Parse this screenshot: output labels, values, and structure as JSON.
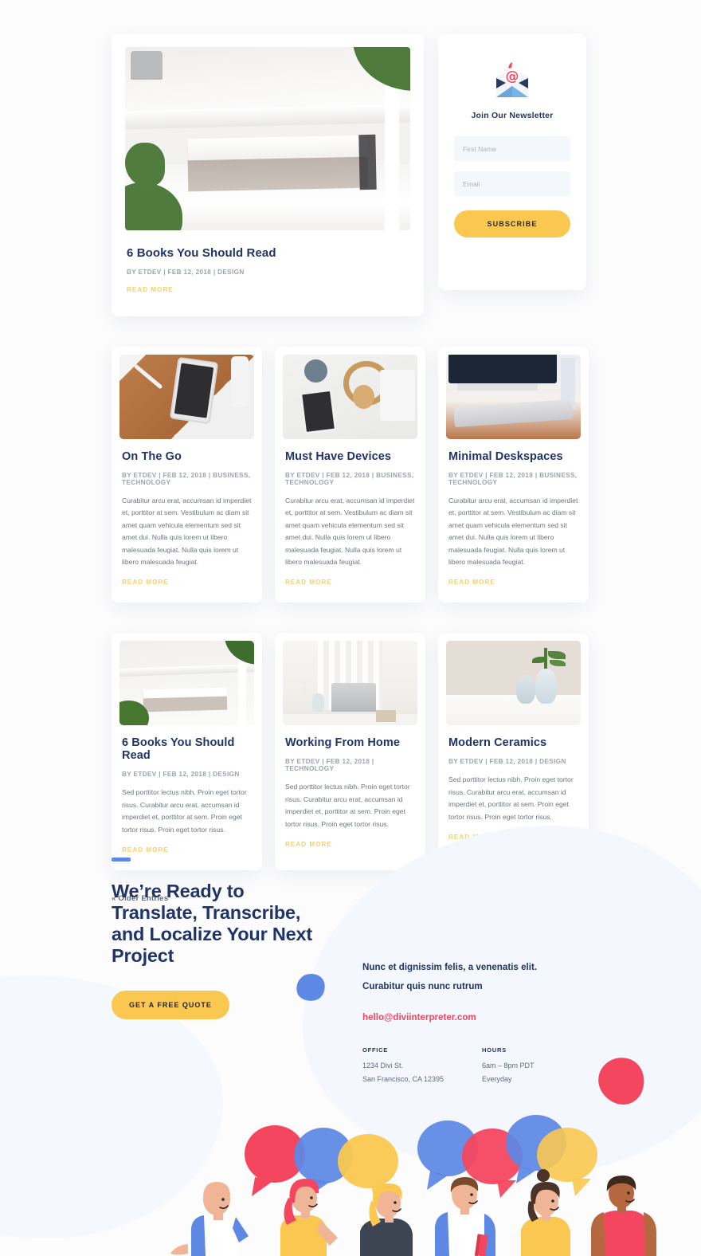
{
  "blog": {
    "featured": {
      "title": "6 Books You Should Read",
      "byline": "BY ETDEV | FEB 12, 2018 | DESIGN",
      "read_more": "READ MORE",
      "image_alt": "white-books-on-shelf"
    },
    "newsletter": {
      "icon": "envelope-at-icon",
      "title": "Join Our Newsletter",
      "first_name_placeholder": "First Name",
      "first_name_value": "",
      "email_placeholder": "Email",
      "email_value": "",
      "subscribe_label": "SUBSCRIBE"
    },
    "posts": [
      {
        "title": "On The Go",
        "byline": "BY ETDEV | FEB 12, 2018 | BUSINESS, TECHNOLOGY",
        "excerpt": "Curabitur arcu erat, accumsan id imperdiet et, porttitor at sem. Vestibulum ac diam sit amet quam vehicula elementum sed sit amet dui. Nulla quis lorem ut libero malesuada feugiat. Nulla quis lorem ut libero malesuada feugiat.",
        "read_more": "READ MORE",
        "image_alt": "phone-on-leather-case"
      },
      {
        "title": "Must Have Devices",
        "byline": "BY ETDEV | FEB 12, 2018 | BUSINESS, TECHNOLOGY",
        "excerpt": "Curabitur arcu erat, accumsan id imperdiet et, porttitor at sem. Vestibulum ac diam sit amet quam vehicula elementum sed sit amet dui. Nulla quis lorem ut libero malesuada feugiat. Nulla quis lorem ut libero malesuada feugiat.",
        "read_more": "READ MORE",
        "image_alt": "headphones-and-phone-on-desk"
      },
      {
        "title": "Minimal Deskspaces",
        "byline": "BY ETDEV | FEB 12, 2018 | BUSINESS, TECHNOLOGY",
        "excerpt": "Curabitur arcu erat, accumsan id imperdiet et, porttitor at sem. Vestibulum ac diam sit amet quam vehicula elementum sed sit amet dui. Nulla quis lorem ut libero malesuada feugiat. Nulla quis lorem ut libero malesuada feugiat.",
        "read_more": "READ MORE",
        "image_alt": "keyboard-and-monitor"
      },
      {
        "title": "6 Books You Should Read",
        "byline": "BY ETDEV | FEB 12, 2018 | DESIGN",
        "excerpt": "Sed porttitor lectus nibh. Proin eget tortor risus. Curabitur arcu erat, accumsan id imperdiet et, porttitor at sem. Proin eget tortor risus. Proin eget tortor risus.",
        "read_more": "READ MORE",
        "image_alt": "white-books-on-shelf"
      },
      {
        "title": "Working From Home",
        "byline": "BY ETDEV | FEB 12, 2018 | TECHNOLOGY",
        "excerpt": "Sed porttitor lectus nibh. Proin eget tortor risus. Curabitur arcu erat, accumsan id imperdiet et, porttitor at sem. Proin eget tortor risus. Proin eget tortor risus.",
        "read_more": "READ MORE",
        "image_alt": "laptop-on-desk-by-curtain"
      },
      {
        "title": "Modern Ceramics",
        "byline": "BY ETDEV | FEB 12, 2018 | DESIGN",
        "excerpt": "Sed porttitor lectus nibh. Proin eget tortor risus. Curabitur arcu erat, accumsan id imperdiet et, porttitor at sem. Proin eget tortor risus. Proin eget tortor risus.",
        "read_more": "READ MORE",
        "image_alt": "two-ceramic-vases-with-plant"
      }
    ],
    "pagination": {
      "older_entries": "« Older Entries"
    }
  },
  "cta": {
    "heading": "We’re Ready to Translate, Transcribe, and Localize Your Next Project",
    "button_label": "GET A FREE QUOTE",
    "lead_line_1": "Nunc et dignissim felis, a venenatis elit.",
    "lead_line_2": "Curabitur quis nunc rutrum",
    "email": "hello@diviinterpreter.com",
    "office": {
      "label": "OFFICE",
      "line_1": "1234 Divi St.",
      "line_2": "San Francisco, CA 12395"
    },
    "hours": {
      "label": "HOURS",
      "line_1": "6am – 8pm PDT",
      "line_2": "Everyday"
    },
    "illustration_alt": "people-with-speech-bubbles-illustration"
  },
  "colors": {
    "navy": "#1f3469",
    "yellow": "#fac850",
    "read_more_gold": "#f7cf6a",
    "coral": "#f4475f",
    "blue": "#5d88e4",
    "muted": "#6d7483",
    "page_bg": "#fcfcfd"
  }
}
